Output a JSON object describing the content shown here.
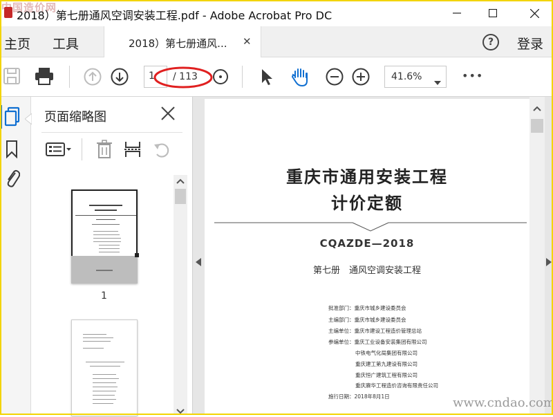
{
  "window": {
    "title": "2018）第七册通风空调安装工程.pdf - Adobe Acrobat Pro DC",
    "watermark_top": "中国造价网",
    "controls": [
      "minimize",
      "maximize",
      "close"
    ]
  },
  "nav": {
    "home": "主页",
    "tools": "工具",
    "doc_tab": "2018）第七册通风...",
    "help": "?",
    "login": "登录"
  },
  "toolbar": {
    "page_current": "1",
    "page_total": "/ 113",
    "zoom": "41.6%",
    "more": "•••"
  },
  "panel": {
    "title": "页面缩略图",
    "thumbnails": [
      {
        "label": "1"
      }
    ]
  },
  "document": {
    "title_line1": "重庆市通用安装工程",
    "title_line2": "计价定额",
    "code": "CQAZDE—2018",
    "subtitle": "第七册　通风空调安装工程",
    "info": [
      "批准部门：重庆市城乡建设委员会",
      "主编部门：重庆市城乡建设委员会",
      "主编单位：重庆市建设工程造价管理总站",
      "参编单位：重庆工业设备安装集团有限公司",
      "中铁电气化局集团有限公司",
      "重庆建工第九建设有限公司",
      "重庆恒广建筑工程有限公司",
      "重庆赓华工程造价咨询有限责任公司",
      "施行日期：2018年8月1日"
    ]
  },
  "watermark_bottom": "www.cndao.com",
  "colors": {
    "frame": "#f3d400",
    "annotation": "#e02020",
    "accent": "#0f6fd1"
  }
}
